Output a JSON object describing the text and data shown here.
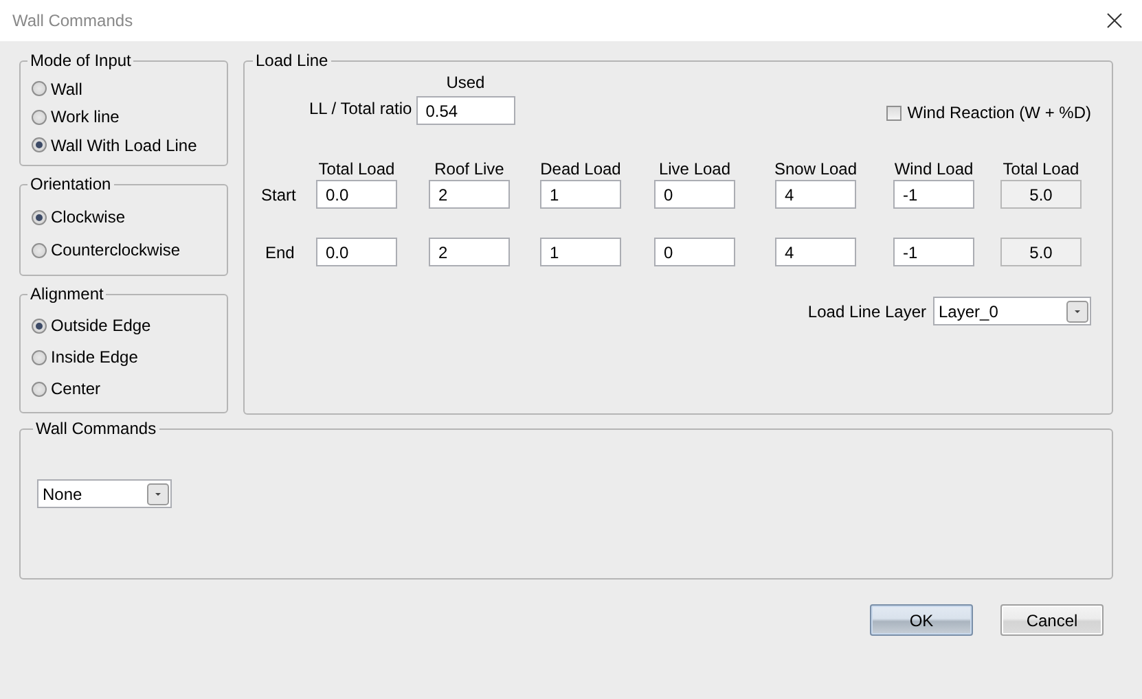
{
  "window": {
    "title": "Wall Commands"
  },
  "mode_of_input": {
    "title": "Mode of Input",
    "options": [
      {
        "label": "Wall",
        "selected": false
      },
      {
        "label": "Work line",
        "selected": false
      },
      {
        "label": "Wall With Load Line",
        "selected": true
      }
    ]
  },
  "orientation": {
    "title": "Orientation",
    "options": [
      {
        "label": "Clockwise",
        "selected": true
      },
      {
        "label": "Counterclockwise",
        "selected": false
      }
    ]
  },
  "alignment": {
    "title": "Alignment",
    "options": [
      {
        "label": "Outside Edge",
        "selected": true
      },
      {
        "label": "Inside Edge",
        "selected": false
      },
      {
        "label": "Center",
        "selected": false
      }
    ]
  },
  "load_line": {
    "title": "Load Line",
    "used_label": "Used",
    "ratio_label": "LL / Total ratio",
    "ratio_value": "0.54",
    "wind_reaction": {
      "label": "Wind Reaction (W + %D)",
      "checked": false
    },
    "columns": [
      "Total Load",
      "Roof Live",
      "Dead Load",
      "Live Load",
      "Snow Load",
      "Wind Load",
      "Total Load"
    ],
    "rows": [
      {
        "label": "Start",
        "values": [
          "0.0",
          "2",
          "1",
          "0",
          "4",
          "-1"
        ],
        "total": "5.0"
      },
      {
        "label": "End",
        "values": [
          "0.0",
          "2",
          "1",
          "0",
          "4",
          "-1"
        ],
        "total": "5.0"
      }
    ],
    "layer": {
      "label": "Load Line Layer",
      "value": "Layer_0"
    }
  },
  "wall_commands": {
    "title": "Wall Commands",
    "value": "None"
  },
  "buttons": [
    {
      "label": "OK",
      "default": true
    },
    {
      "label": "Cancel",
      "default": false
    }
  ]
}
